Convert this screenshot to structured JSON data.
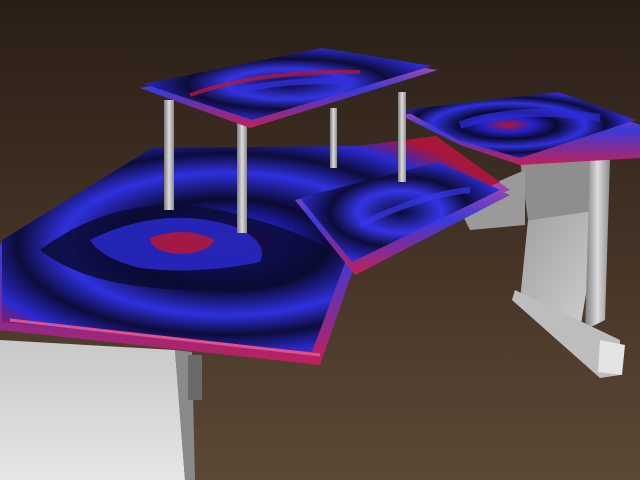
{
  "scene": {
    "subject": "desk-render",
    "colors": {
      "background_top": "#2c2018",
      "background_bottom": "#5a4634",
      "surface_dark": "#0a0a2e",
      "surface_blue": "#2a2ad8",
      "surface_red": "#c21a3a",
      "edge_magenta": "#d0307a",
      "metal_light": "#d8d8d8",
      "metal_mid": "#9a9a9a",
      "metal_dark": "#5c5c5c"
    }
  }
}
